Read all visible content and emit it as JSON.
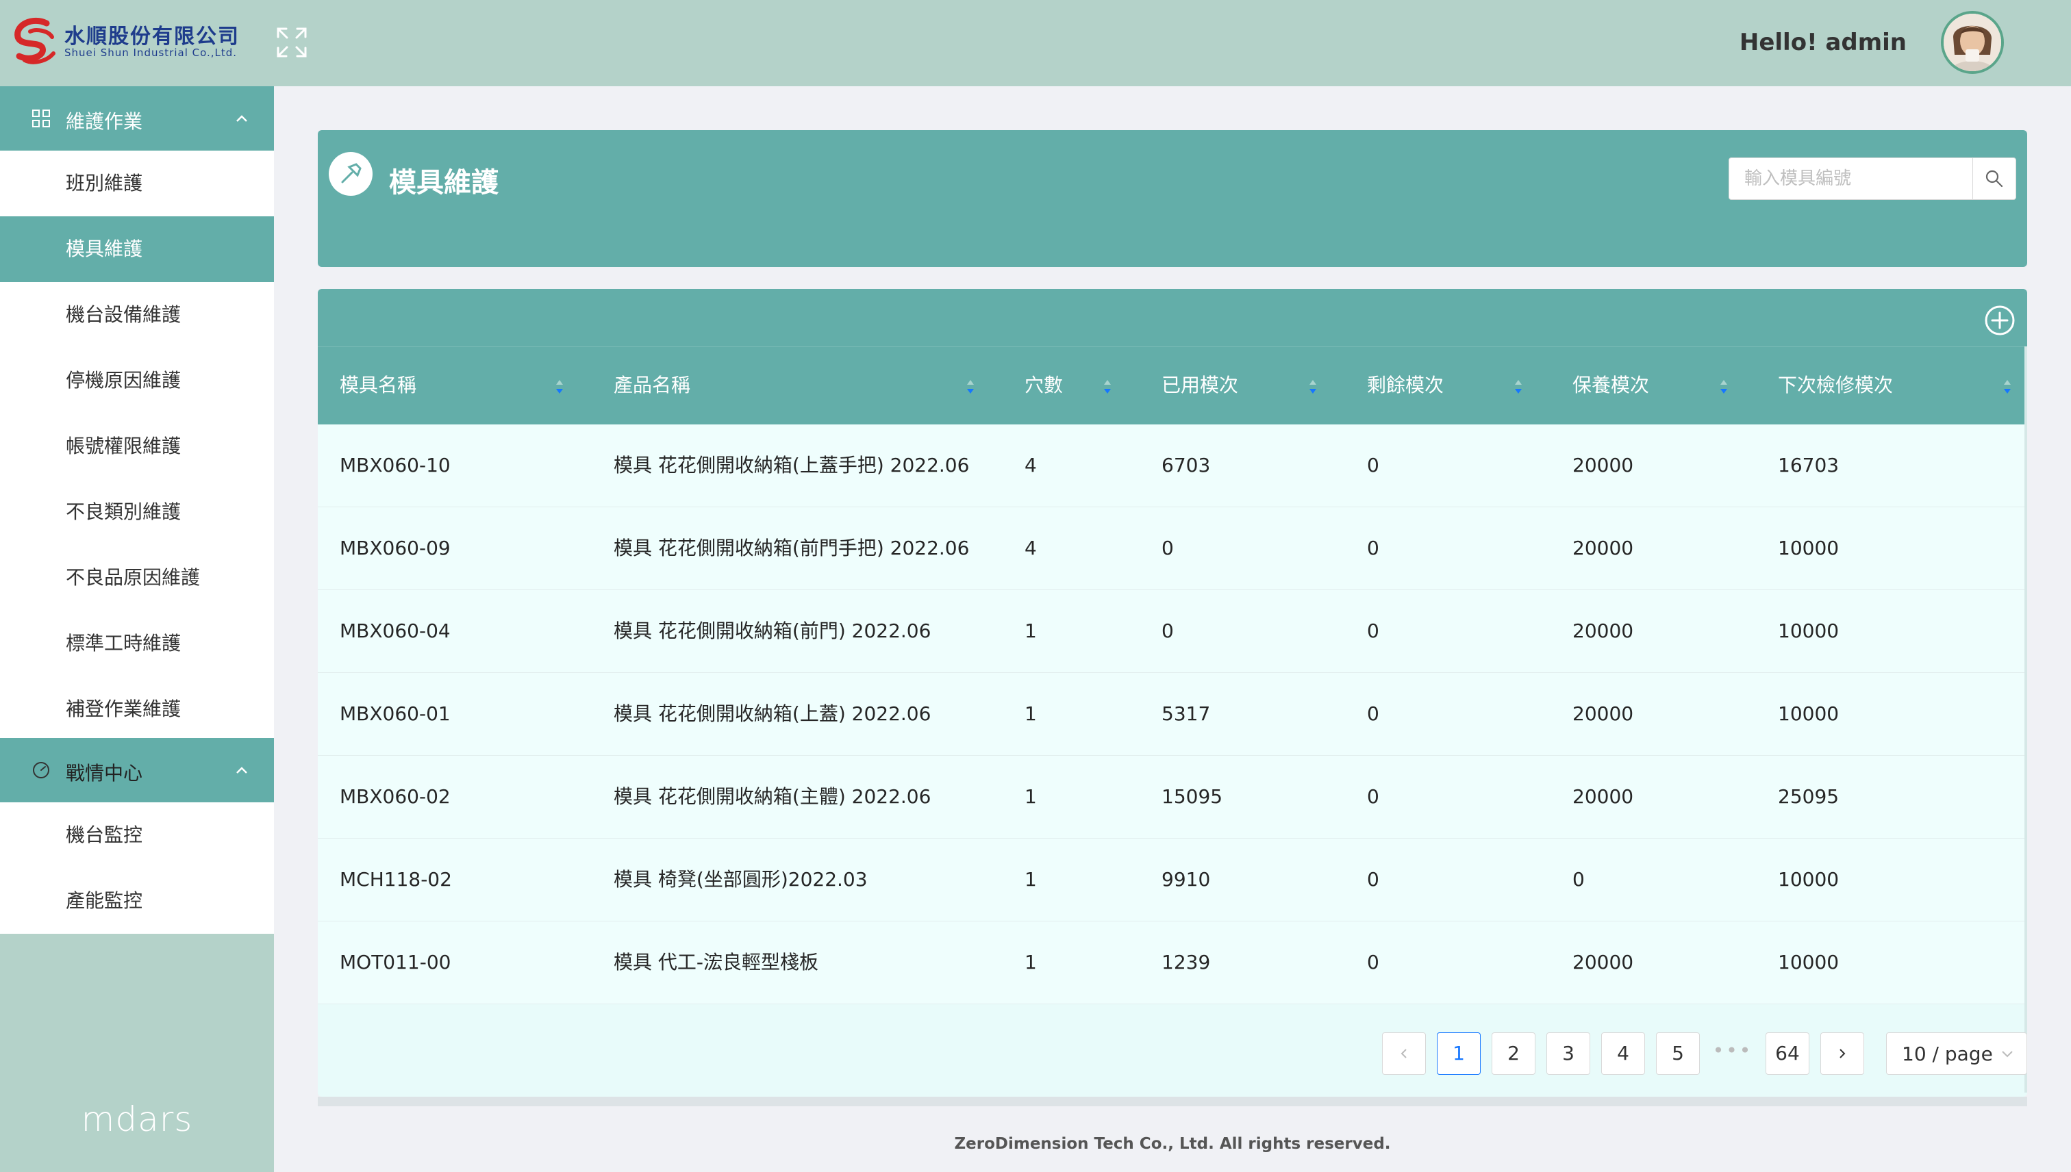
{
  "header": {
    "logo_cn": "水順股份有限公司",
    "logo_en": "Shuei Shun Industrial Co.,Ltd.",
    "greeting_prefix": "Hello! ",
    "username": "admin"
  },
  "sidebar": {
    "groups": [
      {
        "label": "維護作業",
        "items": [
          {
            "label": "班別維護"
          },
          {
            "label": "模具維護",
            "active": true
          },
          {
            "label": "機台設備維護"
          },
          {
            "label": "停機原因維護"
          },
          {
            "label": "帳號權限維護"
          },
          {
            "label": "不良類別維護"
          },
          {
            "label": "不良品原因維護"
          },
          {
            "label": "標準工時維護"
          },
          {
            "label": "補登作業維護"
          }
        ]
      },
      {
        "label": "戰情中心",
        "items": [
          {
            "label": "機台監控"
          },
          {
            "label": "產能監控"
          }
        ]
      }
    ],
    "brand": "mdars"
  },
  "page": {
    "title": "模具維護",
    "search_placeholder": "輸入模具編號"
  },
  "table": {
    "columns": [
      "模具名稱",
      "產品名稱",
      "穴數",
      "已用模次",
      "剩餘模次",
      "保養模次",
      "下次檢修模次"
    ],
    "rows": [
      [
        "MBX060-10",
        "模具 花花側開收納箱(上蓋手把) 2022.06",
        "4",
        "6703",
        "0",
        "20000",
        "16703"
      ],
      [
        "MBX060-09",
        "模具 花花側開收納箱(前門手把) 2022.06",
        "4",
        "0",
        "0",
        "20000",
        "10000"
      ],
      [
        "MBX060-04",
        "模具 花花側開收納箱(前門) 2022.06",
        "1",
        "0",
        "0",
        "20000",
        "10000"
      ],
      [
        "MBX060-01",
        "模具 花花側開收納箱(上蓋) 2022.06",
        "1",
        "5317",
        "0",
        "20000",
        "10000"
      ],
      [
        "MBX060-02",
        "模具 花花側開收納箱(主體) 2022.06",
        "1",
        "15095",
        "0",
        "20000",
        "25095"
      ],
      [
        "MCH118-02",
        "模具 椅凳(坐部圓形)2022.03",
        "1",
        "9910",
        "0",
        "0",
        "10000"
      ],
      [
        "MOT011-00",
        "模具 代工-浤良輕型棧板",
        "1",
        "1239",
        "0",
        "20000",
        "10000"
      ]
    ]
  },
  "pagination": {
    "pages": [
      "1",
      "2",
      "3",
      "4",
      "5"
    ],
    "ellipsis": "•••",
    "last_page": "64",
    "current": "1",
    "page_size": "10 / page"
  },
  "footer": "ZeroDimension Tech Co., Ltd. All rights reserved.",
  "colors": {
    "header_bg": "#b4d2c9",
    "accent": "#63aea9",
    "table_bg": "#effefd",
    "active_page": "#1677ff"
  }
}
